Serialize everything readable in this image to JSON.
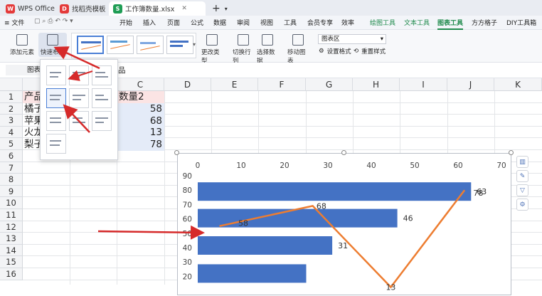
{
  "tabs": {
    "app": "WPS Office",
    "template": "找稻壳模板",
    "file": "工作簿数量.xlsx",
    "add": "+"
  },
  "menu": {
    "file": "文件",
    "items": [
      "开始",
      "插入",
      "页面",
      "公式",
      "数据",
      "审阅",
      "视图",
      "工具",
      "会员专享",
      "效率"
    ],
    "context": [
      "绘图工具",
      "文本工具",
      "图表工具"
    ],
    "extra": [
      "方方格子",
      "DIY工具箱"
    ]
  },
  "ribbon": {
    "add_element": "添加元素",
    "quick_layout": "快速布局",
    "change_type": "更改类型",
    "switch_rowcol": "切换行列",
    "select_data": "选择数据",
    "move_chart": "移动图表",
    "chart_area": "图表区",
    "set_format": "设置格式",
    "reset_style": "重置样式"
  },
  "formula_bar": {
    "name_box": "图表",
    "content": "品"
  },
  "columns": [
    "A",
    "B",
    "C",
    "D",
    "E",
    "F",
    "G",
    "H",
    "I",
    "J",
    "K"
  ],
  "rows": [
    "1",
    "2",
    "3",
    "4",
    "5",
    "6",
    "7",
    "8",
    "9",
    "10",
    "11",
    "12",
    "13",
    "14",
    "15",
    "16"
  ],
  "sheet": {
    "a_col": [
      "产品",
      "橘子",
      "苹果",
      "火龙",
      "梨子"
    ],
    "c_header": "数量2",
    "c_values": [
      "58",
      "68",
      "13",
      "78"
    ]
  },
  "colors": {
    "accent": "#1f8a4c",
    "bar": "#4472c4",
    "line": "#ed7d31",
    "arrow": "#d62a2a"
  },
  "chart_data": {
    "type": "bar",
    "orientation": "horizontal-combo",
    "x_top_ticks": [
      "0",
      "10",
      "20",
      "30",
      "40",
      "50",
      "60",
      "70"
    ],
    "y_ticks": [
      "90",
      "80",
      "70",
      "60",
      "50",
      "40",
      "30",
      "20"
    ],
    "bar_series": {
      "values": [
        63,
        46,
        31,
        25
      ],
      "labels": [
        "63",
        "46",
        "31",
        ""
      ]
    },
    "line_series": {
      "values": [
        58,
        68,
        13,
        78
      ],
      "labels": [
        "58",
        "68",
        "13",
        "78"
      ]
    },
    "x_range": [
      0,
      70
    ],
    "y_range": [
      10,
      90
    ]
  }
}
